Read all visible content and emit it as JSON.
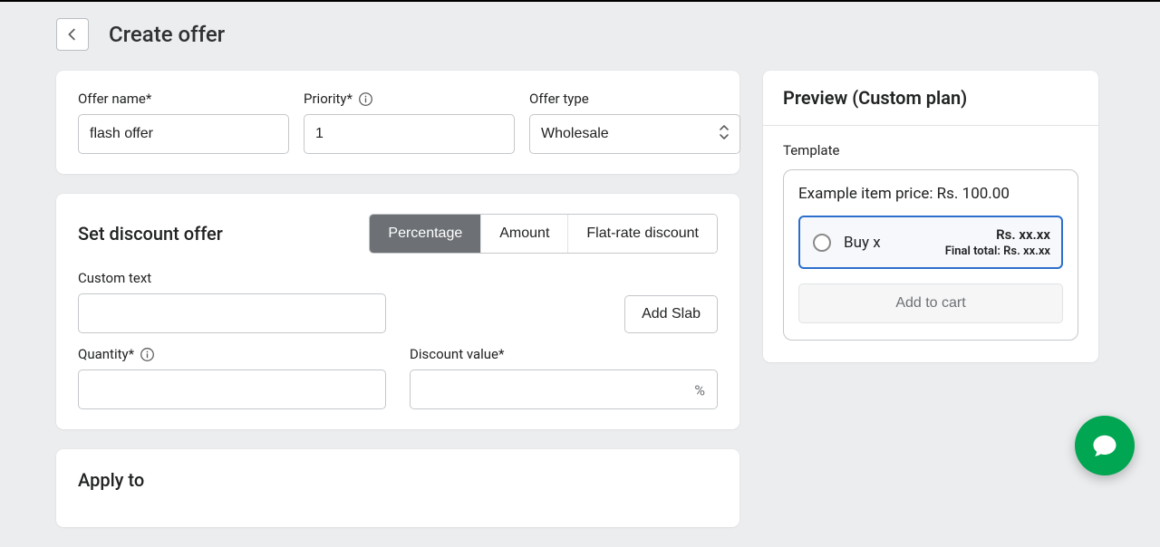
{
  "header": {
    "title": "Create offer"
  },
  "offer": {
    "name_label": "Offer name*",
    "name_value": "flash offer",
    "priority_label": "Priority*",
    "priority_value": "1",
    "type_label": "Offer type",
    "type_value": "Wholesale"
  },
  "discount": {
    "section_title": "Set discount offer",
    "tabs": {
      "percentage": "Percentage",
      "amount": "Amount",
      "flat": "Flat-rate discount"
    },
    "custom_text_label": "Custom text",
    "custom_text_value": "",
    "add_slab": "Add Slab",
    "quantity_label": "Quantity*",
    "quantity_value": "",
    "discount_value_label": "Discount value*",
    "discount_value_value": "",
    "discount_suffix": "%"
  },
  "apply": {
    "section_title": "Apply to"
  },
  "preview": {
    "title": "Preview (Custom plan)",
    "template_label": "Template",
    "example_price": "Example item price: Rs. 100.00",
    "buy_x": "Buy x",
    "price_line": "Rs. xx.xx",
    "final_total": "Final total: Rs. xx.xx",
    "add_to_cart": "Add to cart"
  }
}
